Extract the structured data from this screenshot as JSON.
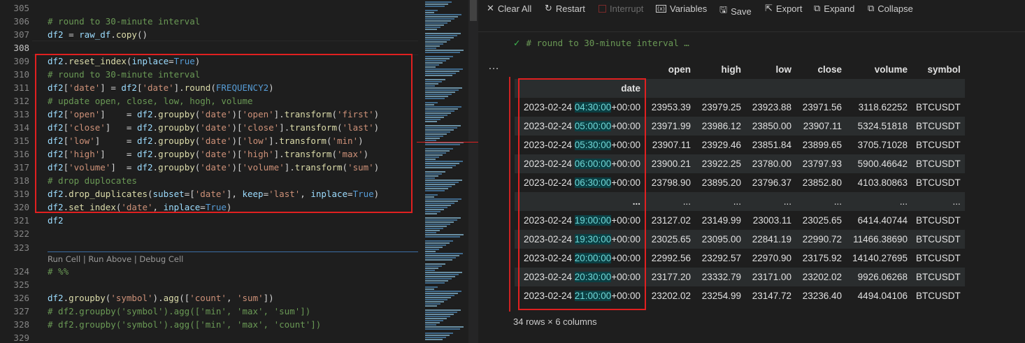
{
  "editor": {
    "lines": [
      {
        "num": "305",
        "text": ""
      },
      {
        "num": "306",
        "text": "# round to 30-minute interval"
      },
      {
        "num": "307",
        "text": "df2 = raw_df.copy()"
      },
      {
        "num": "308",
        "text": ""
      },
      {
        "num": "309",
        "text": "df2.reset_index(inplace=True)"
      },
      {
        "num": "310",
        "text": "# round to 30-minute interval"
      },
      {
        "num": "311",
        "text": "df2['date'] = df2['date'].round(FREQUENCY2)"
      },
      {
        "num": "312",
        "text": "# update open, close, low, hogh, volume"
      },
      {
        "num": "313",
        "text": "df2['open']    = df2.groupby('date')['open'].transform('first')"
      },
      {
        "num": "314",
        "text": "df2['close']   = df2.groupby('date')['close'].transform('last')"
      },
      {
        "num": "315",
        "text": "df2['low']     = df2.groupby('date')['low'].transform('min')"
      },
      {
        "num": "316",
        "text": "df2['high']    = df2.groupby('date')['high'].transform('max')"
      },
      {
        "num": "317",
        "text": "df2['volume']  = df2.groupby('date')['volume'].transform('sum')"
      },
      {
        "num": "318",
        "text": "# drop duplocates"
      },
      {
        "num": "319",
        "text": "df2.drop_duplicates(subset=['date'], keep='last', inplace=True)"
      },
      {
        "num": "320",
        "text": "df2.set_index('date', inplace=True)"
      },
      {
        "num": "321",
        "text": "df2"
      },
      {
        "num": "322",
        "text": ""
      },
      {
        "num": "323",
        "text": ""
      },
      {
        "num": "324",
        "text": "# %%"
      },
      {
        "num": "325",
        "text": ""
      },
      {
        "num": "326",
        "text": "df2.groupby('symbol').agg(['count', 'sum'])"
      },
      {
        "num": "327",
        "text": "# df2.groupby('symbol').agg(['min', 'max', 'sum'])"
      },
      {
        "num": "328",
        "text": "# df2.groupby('symbol').agg(['min', 'max', 'count'])"
      },
      {
        "num": "329",
        "text": ""
      }
    ],
    "codelens": "Run Cell | Run Above | Debug Cell"
  },
  "toolbar": {
    "clear_all": "Clear All",
    "restart": "Restart",
    "interrupt": "Interrupt",
    "variables": "Variables",
    "save": "Save",
    "export": "Export",
    "expand": "Expand",
    "collapse": "Collapse"
  },
  "output": {
    "cell_header": "# round to 30-minute interval …",
    "more": "…",
    "columns": [
      "open",
      "high",
      "low",
      "close",
      "volume",
      "symbol"
    ],
    "index_name": "date",
    "rows": [
      {
        "date": "2023-02-24",
        "time": "04:30:00",
        "tz": "+00:00",
        "open": "23953.39",
        "high": "23979.25",
        "low": "23923.88",
        "close": "23971.56",
        "volume": "3118.62252",
        "symbol": "BTCUSDT"
      },
      {
        "date": "2023-02-24",
        "time": "05:00:00",
        "tz": "+00:00",
        "open": "23971.99",
        "high": "23986.12",
        "low": "23850.00",
        "close": "23907.11",
        "volume": "5324.51818",
        "symbol": "BTCUSDT"
      },
      {
        "date": "2023-02-24",
        "time": "05:30:00",
        "tz": "+00:00",
        "open": "23907.11",
        "high": "23929.46",
        "low": "23851.84",
        "close": "23899.65",
        "volume": "3705.71028",
        "symbol": "BTCUSDT"
      },
      {
        "date": "2023-02-24",
        "time": "06:00:00",
        "tz": "+00:00",
        "open": "23900.21",
        "high": "23922.25",
        "low": "23780.00",
        "close": "23797.93",
        "volume": "5900.46642",
        "symbol": "BTCUSDT"
      },
      {
        "date": "2023-02-24",
        "time": "06:30:00",
        "tz": "+00:00",
        "open": "23798.90",
        "high": "23895.20",
        "low": "23796.37",
        "close": "23852.80",
        "volume": "4103.80863",
        "symbol": "BTCUSDT"
      },
      {
        "ellipsis": true
      },
      {
        "date": "2023-02-24",
        "time": "19:00:00",
        "tz": "+00:00",
        "open": "23127.02",
        "high": "23149.99",
        "low": "23003.11",
        "close": "23025.65",
        "volume": "6414.40744",
        "symbol": "BTCUSDT"
      },
      {
        "date": "2023-02-24",
        "time": "19:30:00",
        "tz": "+00:00",
        "open": "23025.65",
        "high": "23095.00",
        "low": "22841.19",
        "close": "22990.72",
        "volume": "11466.38690",
        "symbol": "BTCUSDT"
      },
      {
        "date": "2023-02-24",
        "time": "20:00:00",
        "tz": "+00:00",
        "open": "22992.56",
        "high": "23292.57",
        "low": "22970.90",
        "close": "23175.92",
        "volume": "14140.27695",
        "symbol": "BTCUSDT"
      },
      {
        "date": "2023-02-24",
        "time": "20:30:00",
        "tz": "+00:00",
        "open": "23177.20",
        "high": "23332.79",
        "low": "23171.00",
        "close": "23202.02",
        "volume": "9926.06268",
        "symbol": "BTCUSDT"
      },
      {
        "date": "2023-02-24",
        "time": "21:00:00",
        "tz": "+00:00",
        "open": "23202.02",
        "high": "23254.99",
        "low": "23147.72",
        "close": "23236.40",
        "volume": "4494.04106",
        "symbol": "BTCUSDT"
      }
    ],
    "row_count": "34 rows × 6 columns"
  },
  "colors": {
    "highlight_box": "#e02020",
    "check": "#3fb950",
    "time_highlight": "#0b3f43"
  }
}
